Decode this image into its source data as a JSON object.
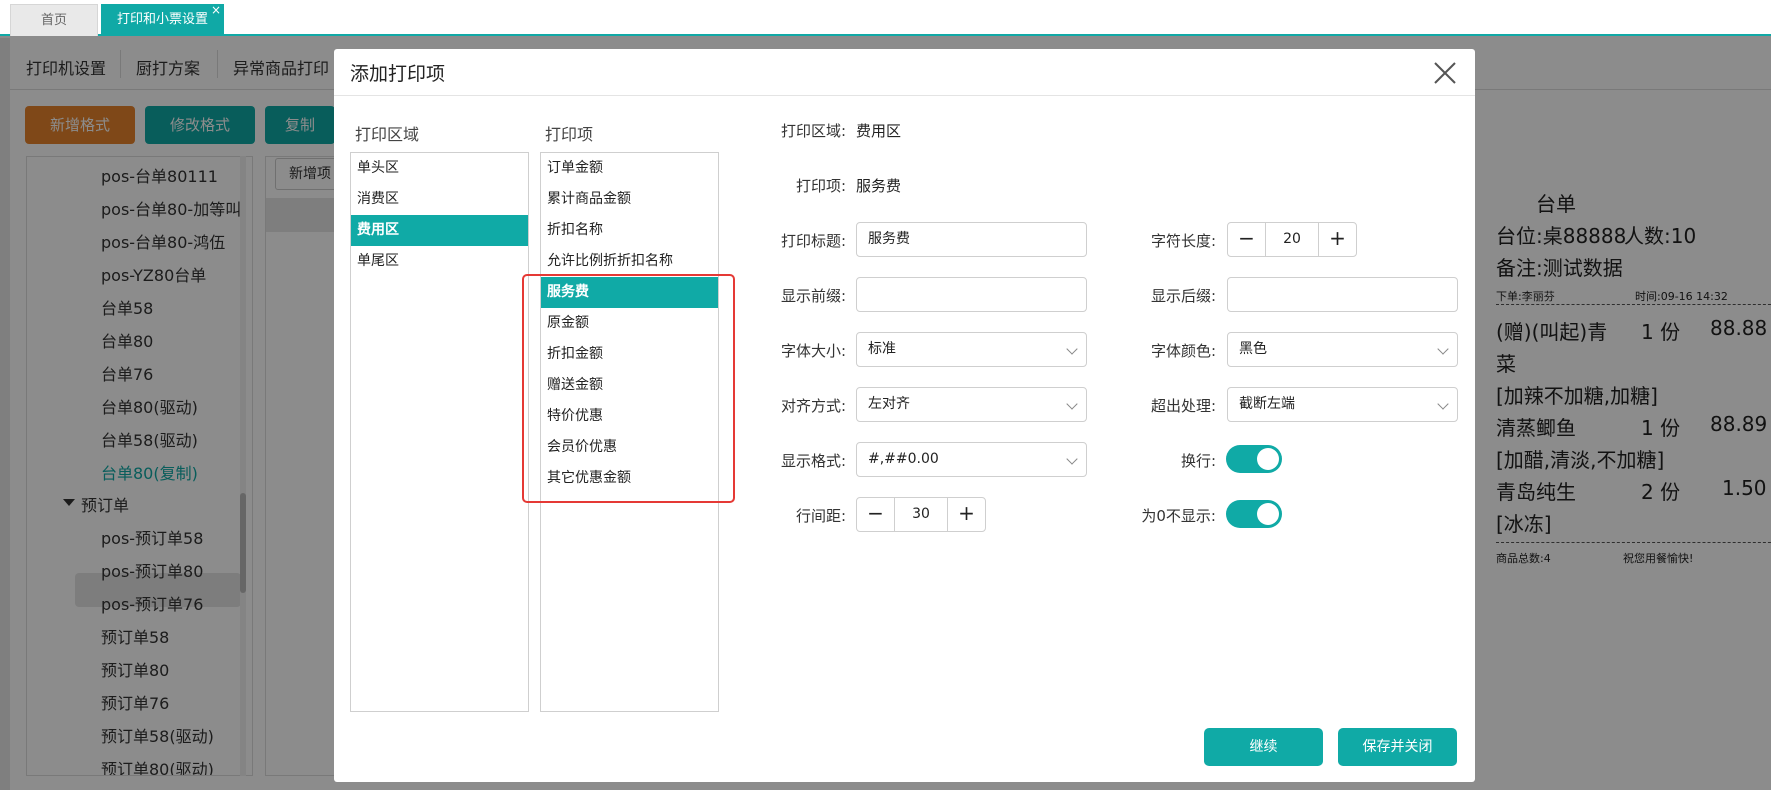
{
  "tabs": {
    "home": "首页",
    "print_settings": "打印和小票设置",
    "close": "×"
  },
  "subnav": [
    "打印机设置",
    "厨打方案",
    "异常商品打印"
  ],
  "bg_buttons": {
    "add_format": "新增格式",
    "edit_format": "修改格式",
    "copy": "复制",
    "add_item": "新增项"
  },
  "tree": {
    "items_top": [
      "pos-台单80111",
      "pos-台单80-加等叫",
      "pos-台单80-鸿伍",
      "pos-YZ80台单",
      "台单58",
      "台单80",
      "台单76",
      "台单80(驱动)",
      "台单58(驱动)",
      "台单80(复制)"
    ],
    "group": "预订单",
    "items_bottom": [
      "pos-预订单58",
      "pos-预订单80",
      "pos-预订单76",
      "预订单58",
      "预订单80",
      "预订单76",
      "预订单58(驱动)",
      "预订单80(驱动)"
    ]
  },
  "receipt": {
    "title": "台单",
    "table": "台位:桌88888",
    "guests": "人数:10",
    "note": "备注:测试数据",
    "orderer": "下单:李丽芬",
    "time": "时间:09-16 14:32",
    "line1_name": "(赠)(叫起)青",
    "line1_qty": "1 份",
    "line1_price": "88.88",
    "line1_cont": "菜",
    "line1_note": "[加辣不加糖,加糖]",
    "line2_name": "清蒸鲫鱼",
    "line2_qty": "1 份",
    "line2_price": "88.89",
    "line2_note": "[加醋,清淡,不加糖]",
    "line3_name": "青岛纯生",
    "line3_qty": "2 份",
    "line3_price": "1.50",
    "line3_note": "[冰冻]",
    "total": "商品总数:4",
    "greeting": "祝您用餐愉快!"
  },
  "modal": {
    "title": "添加打印项",
    "area_col_title": "打印区域",
    "item_col_title": "打印项",
    "areas": [
      "单头区",
      "消费区",
      "费用区",
      "单尾区"
    ],
    "selected_area_index": 2,
    "items": [
      "订单金额",
      "累计商品金额",
      "折扣名称",
      "允许比例折折扣名称",
      "服务费",
      "原金额",
      "折扣金额",
      "赠送金额",
      "特价优惠",
      "会员价优惠",
      "其它优惠金额"
    ],
    "selected_item_index": 4,
    "form": {
      "area_label": "打印区域:",
      "area_value": "费用区",
      "item_label": "打印项:",
      "item_value": "服务费",
      "title_label": "打印标题:",
      "title_value": "服务费",
      "prefix_label": "显示前缀:",
      "prefix_value": "",
      "font_size_label": "字体大小:",
      "font_size_value": "标准",
      "align_label": "对齐方式:",
      "align_value": "左对齐",
      "format_label": "显示格式:",
      "format_value": "#,##0.00",
      "line_spacing_label": "行间距:",
      "line_spacing_value": "30",
      "char_len_label": "字符长度:",
      "char_len_value": "20",
      "suffix_label": "显示后缀:",
      "suffix_value": "",
      "font_color_label": "字体颜色:",
      "font_color_value": "黑色",
      "overflow_label": "超出处理:",
      "overflow_value": "截断左端",
      "wrap_label": "换行:",
      "wrap_on": true,
      "hide_zero_label": "为0不显示:",
      "hide_zero_on": true,
      "minus": "−",
      "plus": "+"
    },
    "buttons": {
      "continue": "继续",
      "save_close": "保存并关闭"
    }
  },
  "colors": {
    "accent": "#10aaa6",
    "orange": "#e8842c",
    "highlight": "#e53935"
  }
}
